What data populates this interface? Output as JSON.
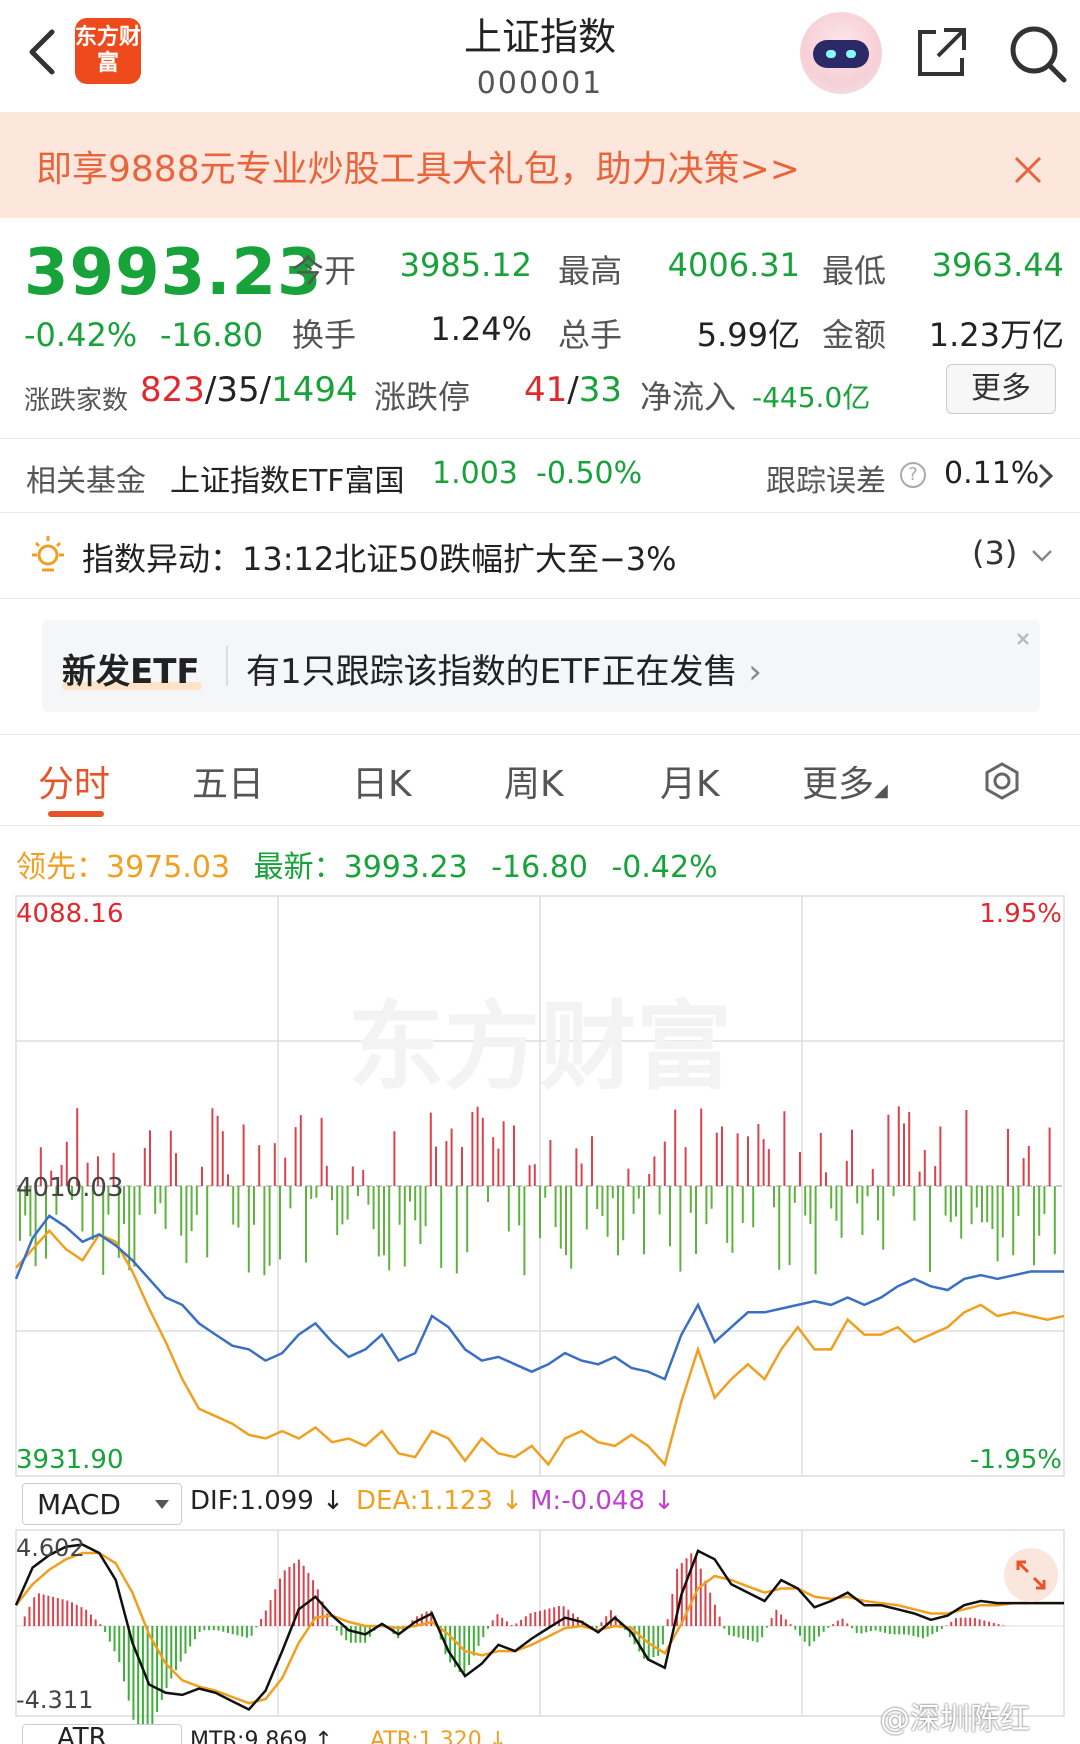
{
  "header": {
    "logo_text": "东方财富",
    "title": "上证指数",
    "code": "000001"
  },
  "promo": {
    "text": "即享9888元专业炒股工具大礼包，助力决策>>"
  },
  "quote": {
    "price": "3993.23",
    "change_pct": "-0.42%",
    "change_val": "-16.80",
    "open_label": "今开",
    "open": "3985.12",
    "high_label": "最高",
    "high": "4006.31",
    "low_label": "最低",
    "low": "3963.44",
    "turnover_label": "换手",
    "turnover": "1.24%",
    "volume_label": "总手",
    "volume": "5.99亿",
    "amount_label": "金额",
    "amount": "1.23万亿",
    "breadth_label": "涨跌家数",
    "breadth_up": "823",
    "breadth_sep1": "/",
    "breadth_flat": "35",
    "breadth_sep2": "/",
    "breadth_down": "1494",
    "limit_label": "涨跌停",
    "limit_up": "41",
    "limit_sep": "/",
    "limit_down": "33",
    "netflow_label": "净流入",
    "netflow": "-445.0亿",
    "more_label": "更多"
  },
  "fund": {
    "label": "相关基金",
    "name": "上证指数ETF富国",
    "value": "1.003",
    "change": "-0.50%",
    "track_label": "跟踪误差",
    "help": "?",
    "track_value": "0.11%"
  },
  "alert": {
    "text": "指数异动：13:12北证50跌幅扩大至−3%",
    "count": "(3)"
  },
  "etf_card": {
    "tag": "新发ETF",
    "text": "有1只跟踪该指数的ETF正在发售"
  },
  "tabs": [
    {
      "label": "分时"
    },
    {
      "label": "五日"
    },
    {
      "label": "日K"
    },
    {
      "label": "周K"
    },
    {
      "label": "月K"
    },
    {
      "label": "更多"
    }
  ],
  "legend": {
    "lead_label": "领先：",
    "lead_value": "3975.03",
    "latest_label": "最新：",
    "latest_value": "3993.23",
    "latest_change": "-16.80",
    "latest_pct": "-0.42%"
  },
  "chart_data": [
    {
      "type": "line",
      "title": "",
      "watermark": "东方财富",
      "y_top_label": "4088.16",
      "y_mid_label": "4010.03",
      "y_bottom_label": "3931.90",
      "pct_top_label": "1.95%",
      "pct_bottom_label": "-1.95%",
      "ylim": [
        3931.9,
        4088.16
      ],
      "prev_close": 4010.03,
      "series": [
        {
          "name": "最新",
          "color": "#3a6fc4",
          "values": [
            3985,
            3996,
            4002,
            3999,
            3995,
            3997,
            3994,
            3990,
            3985,
            3980,
            3978,
            3973,
            3970,
            3967,
            3966,
            3963,
            3965,
            3970,
            3973,
            3968,
            3964,
            3966,
            3970,
            3963,
            3965,
            3975,
            3972,
            3966,
            3963,
            3964,
            3962,
            3960,
            3962,
            3965,
            3963,
            3962,
            3964,
            3961,
            3960,
            3958,
            3970,
            3978,
            3968,
            3972,
            3976,
            3976,
            3977,
            3978,
            3979,
            3978,
            3980,
            3978,
            3980,
            3983,
            3985,
            3983,
            3982,
            3985,
            3986,
            3985,
            3986,
            3987,
            3987,
            3987
          ]
        },
        {
          "name": "领先",
          "color": "#f0a020",
          "values": [
            3988,
            3993,
            3998,
            3993,
            3990,
            3997,
            3995,
            3987,
            3977,
            3968,
            3958,
            3950,
            3948,
            3946,
            3943,
            3942,
            3944,
            3942,
            3945,
            3941,
            3942,
            3940,
            3944,
            3938,
            3937,
            3944,
            3942,
            3936,
            3942,
            3938,
            3937,
            3940,
            3935,
            3942,
            3944,
            3941,
            3940,
            3943,
            3940,
            3935,
            3952,
            3966,
            3953,
            3958,
            3962,
            3958,
            3966,
            3972,
            3966,
            3966,
            3974,
            3970,
            3970,
            3972,
            3968,
            3970,
            3972,
            3976,
            3978,
            3975,
            3976,
            3975,
            3974,
            3975
          ]
        }
      ],
      "bars_note": "volume / buy-sell bars around prev close line"
    },
    {
      "type": "bar",
      "title": "MACD",
      "y_top_label": "4.602",
      "y_bottom_label": "-4.311",
      "ylim": [
        -4.311,
        4.602
      ],
      "series": [
        {
          "name": "DIF",
          "color": "#111111",
          "values": [
            1.0,
            2.8,
            3.4,
            3.8,
            3.9,
            3.5,
            2.2,
            -0.8,
            -2.8,
            -3.2,
            -3.3,
            -3.0,
            -3.2,
            -3.6,
            -4.0,
            -3.1,
            -1.2,
            0.8,
            1.4,
            0.5,
            -0.2,
            -0.4,
            0.1,
            -0.4,
            0.2,
            0.6,
            -1.2,
            -2.4,
            -1.8,
            -0.9,
            -1.2,
            -0.6,
            -0.1,
            0.4,
            0.2,
            -0.3,
            0.4,
            -0.3,
            -1.6,
            -2.0,
            1.5,
            3.6,
            3.2,
            2.0,
            1.6,
            1.2,
            2.2,
            1.8,
            0.9,
            1.2,
            1.6,
            1.0,
            1.0,
            0.8,
            0.6,
            0.3,
            0.5,
            1.0,
            1.2,
            1.1,
            1.1,
            1.1,
            1.1,
            1.1
          ]
        },
        {
          "name": "DEA",
          "color": "#f0a020",
          "values": [
            1.0,
            2.0,
            2.7,
            3.2,
            3.5,
            3.5,
            3.0,
            1.6,
            -0.4,
            -1.8,
            -2.6,
            -2.9,
            -3.1,
            -3.4,
            -3.7,
            -3.5,
            -2.5,
            -0.8,
            0.4,
            0.5,
            0.2,
            0.0,
            0.0,
            -0.1,
            0.0,
            0.2,
            -0.4,
            -1.2,
            -1.4,
            -1.2,
            -1.2,
            -0.9,
            -0.5,
            -0.1,
            0.0,
            -0.2,
            0.0,
            -0.1,
            -0.8,
            -1.3,
            0.1,
            1.8,
            2.4,
            2.2,
            1.9,
            1.6,
            1.8,
            1.8,
            1.4,
            1.3,
            1.4,
            1.2,
            1.1,
            1.0,
            0.8,
            0.6,
            0.6,
            0.8,
            1.0,
            1.0,
            1.1,
            1.1,
            1.1,
            1.1
          ]
        }
      ]
    }
  ],
  "macd": {
    "select_label": "MACD",
    "dif": "DIF:1.099 ↓",
    "dea": "DEA:1.123 ↓",
    "m": "M:-0.048 ↓"
  },
  "atr": {
    "select_label": "ATR",
    "mtr": "MTR:9.869 ↑",
    "atr": "ATR:1.320 ↓"
  },
  "watermark_site": "@深圳陈红"
}
